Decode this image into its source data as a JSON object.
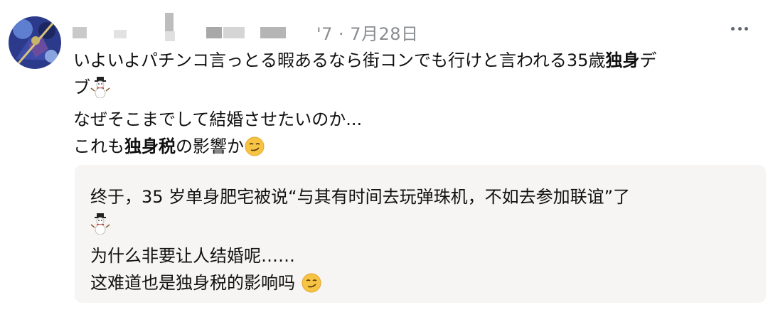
{
  "post": {
    "date": "'7 · 7月28日",
    "body": {
      "line1": "いよいよパチンコ言っとる暇あるなら街コンでも行けと言われる35歳",
      "line1_bold": "独身",
      "line1_tail": "デ",
      "line2": "ブ",
      "line3": "なぜそこまでして結婚させたいのか...",
      "line4_pre": "これも",
      "line4_bold": "独身税",
      "line4_post": "の影響か"
    },
    "translation": {
      "line1": "终于，35 岁单身肥宅被说“与其有时间去玩弹珠机，不如去参加联谊”了",
      "line3": "为什么非要让人结婚呢……",
      "line4": "这难道也是独身税的影响吗 "
    },
    "icons": {
      "avatar": "avatar-image",
      "more": "more-options-icon",
      "snowman": "snowman-emoji",
      "smirk": "smirk-emoji"
    }
  }
}
